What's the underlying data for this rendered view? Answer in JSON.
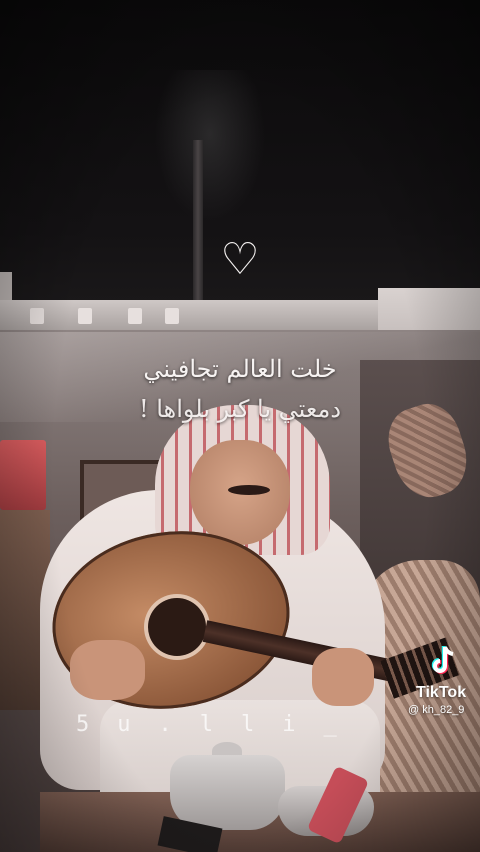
{
  "overlay": {
    "heart_icon": "♡",
    "lyric_line1": "خلت العالم تجافيني",
    "lyric_line2": "دمعتي يا كبر بلواها !",
    "watermark_text": "5u.lli_"
  },
  "tiktok": {
    "brand": "TikTok",
    "handle": "@ kh_82_9",
    "logo_icon": "tiktok-note-icon"
  }
}
